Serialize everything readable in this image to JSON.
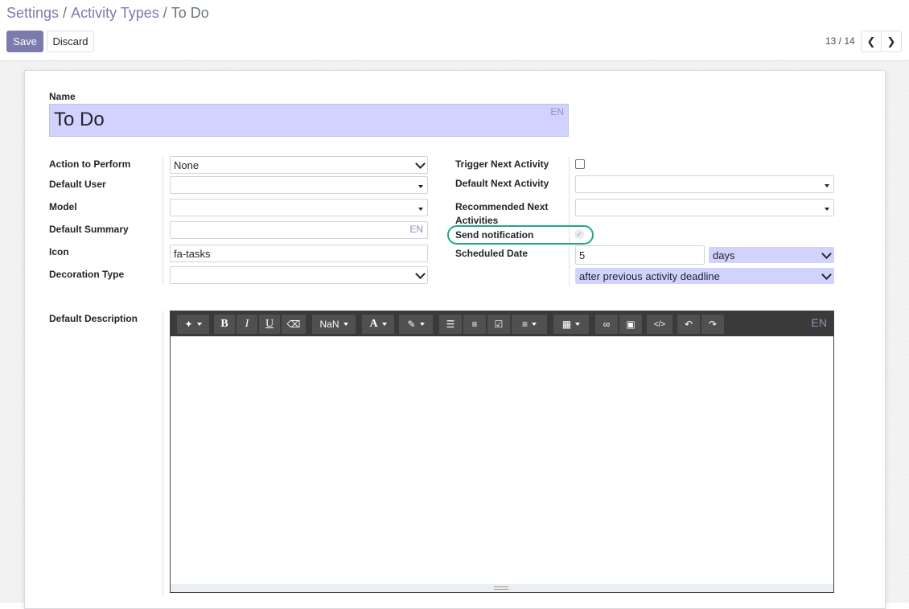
{
  "breadcrumb": {
    "items": [
      {
        "label": "Settings"
      },
      {
        "label": "Activity Types"
      },
      {
        "label": "To Do"
      }
    ],
    "separator": "/"
  },
  "toolbar": {
    "save_label": "Save",
    "discard_label": "Discard"
  },
  "pager": {
    "value": "13 / 14",
    "prev_icon": "chevron-left-icon",
    "next_icon": "chevron-right-icon"
  },
  "form": {
    "name_label": "Name",
    "name_value": "To Do",
    "lang_tag": "EN",
    "left": {
      "action_to_perform": {
        "label": "Action to Perform",
        "value": "None"
      },
      "default_user": {
        "label": "Default User",
        "value": ""
      },
      "model": {
        "label": "Model",
        "value": ""
      },
      "default_summary": {
        "label": "Default Summary",
        "value": ""
      },
      "icon": {
        "label": "Icon",
        "value": "fa-tasks"
      },
      "decoration_type": {
        "label": "Decoration Type",
        "value": ""
      }
    },
    "right": {
      "trigger_next_activity": {
        "label": "Trigger Next Activity",
        "checked": false
      },
      "default_next_activity": {
        "label": "Default Next Activity",
        "value": ""
      },
      "recommended_next_activities": {
        "label": "Recommended Next Activities",
        "value": ""
      },
      "send_notification": {
        "label": "Send notification",
        "checked": true
      },
      "scheduled_date": {
        "label": "Scheduled Date",
        "value": "5",
        "unit": "days",
        "relation": "after previous activity deadline"
      }
    },
    "default_description": {
      "label": "Default Description",
      "toolbar": [
        {
          "name": "magic-wand-icon",
          "glyph": "✦",
          "dropdown": true
        },
        {
          "name": "bold-icon",
          "glyph": "B"
        },
        {
          "name": "italic-icon",
          "glyph": "I"
        },
        {
          "name": "underline-icon",
          "glyph": "U"
        },
        {
          "name": "eraser-icon",
          "glyph": "⌫"
        },
        {
          "name": "font-size-dropdown",
          "glyph": "NaN",
          "dropdown": true
        },
        {
          "name": "font-color-icon",
          "glyph": "A",
          "dropdown": true
        },
        {
          "name": "paint-brush-icon",
          "glyph": "✎",
          "dropdown": true
        },
        {
          "name": "unordered-list-icon",
          "glyph": "☰"
        },
        {
          "name": "ordered-list-icon",
          "glyph": "≡"
        },
        {
          "name": "checklist-icon",
          "glyph": "☑"
        },
        {
          "name": "align-icon",
          "glyph": "≡",
          "dropdown": true
        },
        {
          "name": "table-icon",
          "glyph": "▦",
          "dropdown": true
        },
        {
          "name": "link-icon",
          "glyph": "∞"
        },
        {
          "name": "image-icon",
          "glyph": "▣"
        },
        {
          "name": "code-view-icon",
          "glyph": "</>"
        },
        {
          "name": "undo-icon",
          "glyph": "↶"
        },
        {
          "name": "redo-icon",
          "glyph": "↷"
        }
      ],
      "value": ""
    }
  },
  "colors": {
    "brand": "#7c7bad",
    "required_field_bg": "#d2d2ff",
    "highlight": "#21a882"
  }
}
